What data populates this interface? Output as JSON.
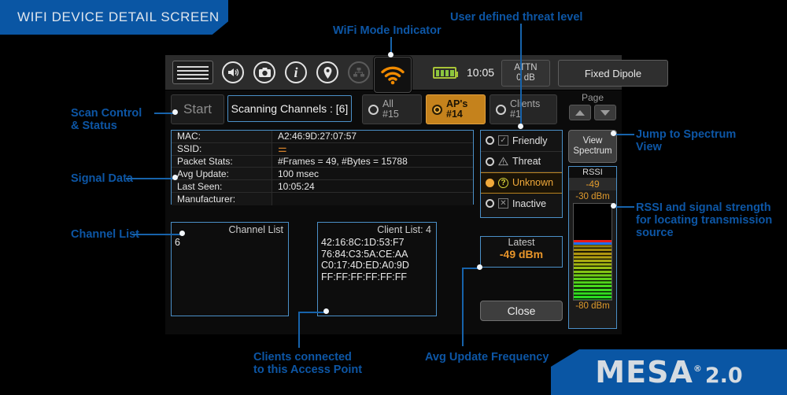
{
  "banner": {
    "title": "WIFI DEVICE DETAIL SCREEN"
  },
  "logo": {
    "name": "MESA",
    "reg": "®",
    "version": "2.0"
  },
  "toolbar": {
    "icons": [
      {
        "name": "menu-icon",
        "glyph": ""
      },
      {
        "name": "speaker-icon",
        "glyph": "◀"
      },
      {
        "name": "camera-icon",
        "glyph": "●"
      },
      {
        "name": "info-icon",
        "glyph": "i"
      },
      {
        "name": "location-pin-icon",
        "glyph": "●"
      },
      {
        "name": "network-nodes-icon",
        "glyph": "▣"
      }
    ],
    "wifi_mode": "wifi-icon",
    "clock": "10:05",
    "attn_label": "ATTN",
    "attn_value": "0 dB",
    "antenna": "Fixed Dipole"
  },
  "controls": {
    "start_label": "Start",
    "scanning_label": "Scanning Channels : [6]",
    "filters": [
      {
        "label": "All",
        "count": "#15",
        "selected": false
      },
      {
        "label": "AP's",
        "count": "#14",
        "selected": true
      },
      {
        "label": "Clients",
        "count": "#1",
        "selected": false
      }
    ],
    "page_label": "Page"
  },
  "detail": {
    "rows": [
      {
        "key": "MAC:",
        "value": "A2:46:9D:27:07:57"
      },
      {
        "key": "SSID:",
        "value": ""
      },
      {
        "key": "Packet Stats:",
        "value": "#Frames = 49, #Bytes = 15788"
      },
      {
        "key": "Avg Update:",
        "value": "100 msec"
      },
      {
        "key": "Last Seen:",
        "value": "10:05:24"
      },
      {
        "key": "Manufacturer:",
        "value": ""
      }
    ]
  },
  "threat": {
    "options": [
      {
        "label": "Friendly",
        "icon": "check-icon",
        "glyph": "✓",
        "selected": false
      },
      {
        "label": "Threat",
        "icon": "warning-triangle-icon",
        "glyph": "!",
        "selected": false
      },
      {
        "label": "Unknown",
        "icon": "question-circle-icon",
        "glyph": "?",
        "selected": true
      },
      {
        "label": "Inactive",
        "icon": "cross-box-icon",
        "glyph": "✕",
        "selected": false
      }
    ]
  },
  "spectrum_button": {
    "line1": "View",
    "line2": "Spectrum"
  },
  "rssi": {
    "header": "RSSI",
    "value": "-49",
    "top_scale": "-30 dBm",
    "bottom_scale": "-80 dBm",
    "peak_color": "#e81c1c",
    "current_color": "#1f6ff0"
  },
  "channel_list": {
    "header": "Channel List",
    "items": "6"
  },
  "client_list": {
    "header": "Client List: 4",
    "items": "42:16:8C:1D:53:F7\n76:84:C3:5A:CE:AA\nC0:17:4D:ED:A0:9D\nFF:FF:FF:FF:FF:FF"
  },
  "latest": {
    "header": "Latest",
    "value": "-49 dBm"
  },
  "close_button": {
    "label": "Close"
  },
  "annotations": {
    "scan_control": "Scan Control\n& Status",
    "signal_data": "Signal Data",
    "channel_list": "Channel List",
    "wifi_mode": "WiFi Mode Indicator",
    "threat_level": "User defined threat level",
    "jump_spectrum": "Jump to Spectrum\nView",
    "rssi_strength": "RSSI and signal strength\nfor locating transmission\nsource",
    "clients_connected": "Clients connected\nto this Access Point",
    "avg_update": "Avg Update Frequency"
  },
  "colors": {
    "accent_blue": "#0a56a4",
    "highlight_orange": "#c5821c",
    "border_blue": "#4b90c8"
  }
}
